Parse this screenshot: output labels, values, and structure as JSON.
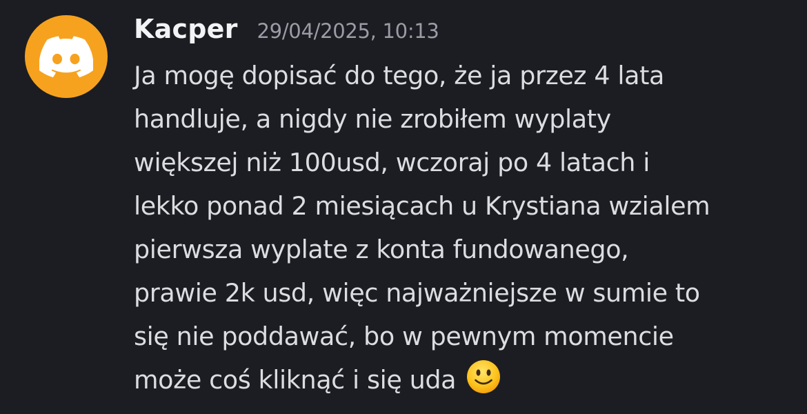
{
  "message": {
    "author": "Kacper",
    "timestamp": "29/04/2025, 10:13",
    "lines": [
      "Ja mogę dopisać do tego, że ja przez 4 lata",
      "handluje, a nigdy nie zrobiłem wyplaty",
      "większej niż 100usd, wczoraj po 4 latach i",
      "lekko ponad 2 miesiącach u Krystiana wzialem",
      "pierwsza wyplate z konta fundowanego,",
      "prawie 2k usd, więc najważniejsze w sumie to",
      "się nie poddawać, bo w pewnym momencie",
      "może coś kliknąć i się uda"
    ],
    "emoji": "slightly-smiling-face-icon"
  },
  "avatar": {
    "icon": "discord-logo-icon",
    "background": "#f6a21f"
  },
  "colors": {
    "background": "#1c1d22",
    "author": "#f2f3f5",
    "timestamp": "#9b9ca6",
    "text": "#dcdde1"
  }
}
